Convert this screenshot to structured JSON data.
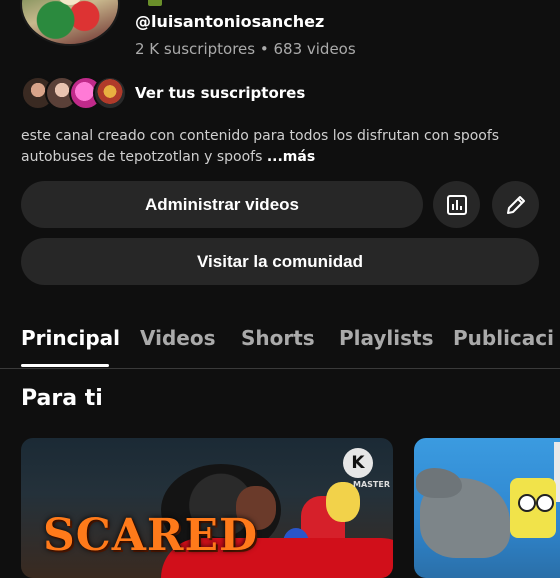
{
  "channel": {
    "handle": "@luisantoniosanchez",
    "stats": "2 K suscriptores • 683 videos",
    "see_subscribers": "Ver tus suscriptores",
    "description": "este canal creado con contenido para todos los disfrutan con spoofs autobuses de tepotzotlan y spoofs ",
    "more": "...más"
  },
  "actions": {
    "manage_videos": "Administrar videos",
    "visit_community": "Visitar la comunidad",
    "stats_icon": "bar-chart-icon",
    "edit_icon": "pencil-icon"
  },
  "tabs": [
    {
      "label": "Principal",
      "active": true
    },
    {
      "label": "Videos"
    },
    {
      "label": "Shorts"
    },
    {
      "label": "Playlists"
    },
    {
      "label": "Publicaci"
    }
  ],
  "section": {
    "title": "Para ti"
  },
  "thumbnails": [
    {
      "title_text": "SCARED",
      "logo_text": "K",
      "logo_caption": "MASTER"
    },
    {}
  ]
}
